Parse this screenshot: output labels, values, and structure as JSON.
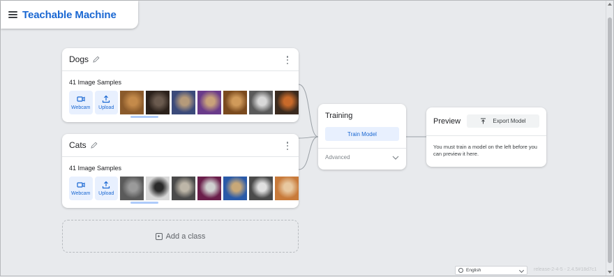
{
  "header": {
    "title": "Teachable Machine"
  },
  "classes": [
    {
      "name": "Dogs",
      "sample_count": "41 Image Samples",
      "webcam_label": "Webcam",
      "upload_label": "Upload",
      "thumbs": [
        {
          "c1": "#8a5a2b",
          "c2": "#c48a4a"
        },
        {
          "c1": "#2b211b",
          "c2": "#6a5a4e"
        },
        {
          "c1": "#3b4a7a",
          "c2": "#b59a7a"
        },
        {
          "c1": "#6a3b8a",
          "c2": "#c9a27a"
        },
        {
          "c1": "#7a4a1e",
          "c2": "#d09a5a"
        },
        {
          "c1": "#5a5a5a",
          "c2": "#d8d8d8"
        },
        {
          "c1": "#3a2a1e",
          "c2": "#c86a2a"
        }
      ]
    },
    {
      "name": "Cats",
      "sample_count": "41 Image Samples",
      "webcam_label": "Webcam",
      "upload_label": "Upload",
      "thumbs": [
        {
          "c1": "#5a5a5a",
          "c2": "#9a9a9a"
        },
        {
          "c1": "#d8d8d8",
          "c2": "#2a2a2a"
        },
        {
          "c1": "#4a4a4a",
          "c2": "#bdb6a8"
        },
        {
          "c1": "#6a1e4a",
          "c2": "#d0d0d0"
        },
        {
          "c1": "#2a5aa8",
          "c2": "#c8a878"
        },
        {
          "c1": "#4a4a4a",
          "c2": "#e0e0e0"
        },
        {
          "c1": "#c87a3a",
          "c2": "#e8c8a0"
        }
      ]
    }
  ],
  "add_class": {
    "label": "Add a class"
  },
  "training": {
    "title": "Training",
    "button": "Train Model",
    "advanced": "Advanced"
  },
  "preview": {
    "title": "Preview",
    "export_button": "Export Model",
    "message": "You must train a model on the left before you can preview it here."
  },
  "footer": {
    "language": "English",
    "release": "release-2-4-5 - 2.4.5#18d7c1"
  },
  "colors": {
    "accent": "#1967d2",
    "accent_light": "#e8f0fe",
    "background": "#e8eaed"
  }
}
